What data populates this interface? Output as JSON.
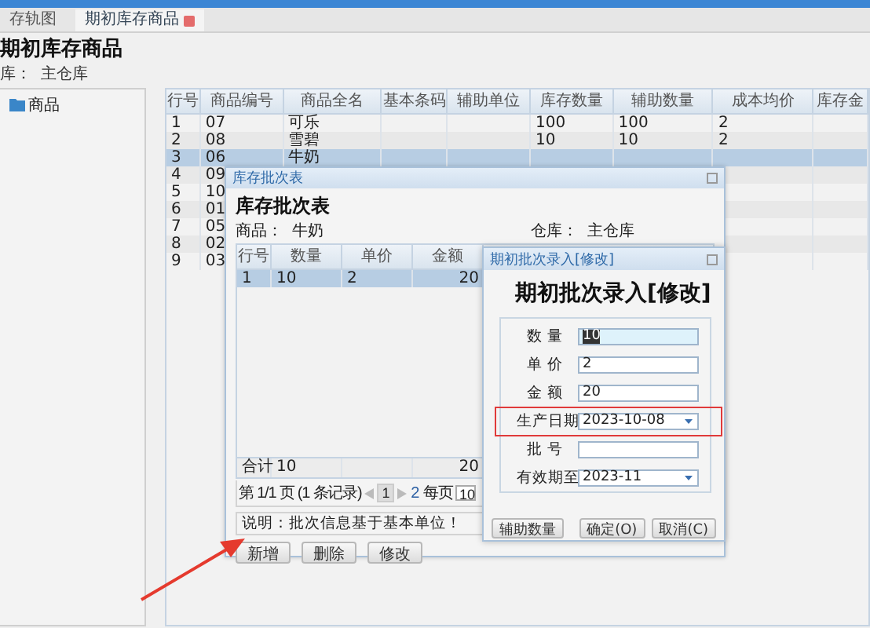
{
  "tabs": [
    {
      "label": "存轨图",
      "selected": false,
      "closable": false
    },
    {
      "label": "期初库存商品",
      "selected": true,
      "closable": true
    }
  ],
  "page": {
    "title": "期初库存商品",
    "warehouse_label": "库：",
    "warehouse": "主仓库"
  },
  "tree": {
    "items": [
      {
        "label": "商品"
      }
    ]
  },
  "grid": {
    "columns": [
      "行号",
      "商品编号",
      "商品全名",
      "基本条码",
      "辅助单位",
      "库存数量",
      "辅助数量",
      "成本均价",
      "库存金"
    ],
    "rows": [
      {
        "cells": [
          "1",
          "07",
          "可乐",
          "",
          "",
          "100",
          "100",
          "2",
          ""
        ],
        "selected": false
      },
      {
        "cells": [
          "2",
          "08",
          "雪碧",
          "",
          "",
          "10",
          "10",
          "2",
          ""
        ],
        "selected": false
      },
      {
        "cells": [
          "3",
          "06",
          "牛奶",
          "",
          "",
          "",
          "",
          "",
          ""
        ],
        "selected": true
      },
      {
        "cells": [
          "4",
          "09"
        ],
        "selected": false
      },
      {
        "cells": [
          "5",
          "10"
        ],
        "selected": false
      },
      {
        "cells": [
          "6",
          "01"
        ],
        "selected": false
      },
      {
        "cells": [
          "7",
          "05"
        ],
        "selected": false
      },
      {
        "cells": [
          "8",
          "02"
        ],
        "selected": false
      },
      {
        "cells": [
          "9",
          "03"
        ],
        "selected": false
      }
    ]
  },
  "batch_dialog": {
    "title": "库存批次表",
    "heading": "库存批次表",
    "product_label": "商品：",
    "product": "牛奶",
    "warehouse_label": "仓库：",
    "warehouse": "主仓库",
    "columns": [
      "行号",
      "数量",
      "单价",
      "金额"
    ],
    "rows": [
      {
        "cells": [
          "1",
          "10",
          "2",
          "20"
        ],
        "selected": true
      }
    ],
    "total": {
      "label": "合计",
      "cells": [
        "10",
        "",
        "20"
      ]
    },
    "pager": {
      "page_text": "第 1/1 页 (1 条记录)",
      "current": "1",
      "next": "2",
      "per_page_label": "每页",
      "per_page": "10"
    },
    "note": "说明：批次信息基于基本单位！",
    "buttons": [
      "新增",
      "删除",
      "修改"
    ]
  },
  "edit_dialog": {
    "title": "期初批次录入[修改]",
    "heading": "期初批次录入[修改]",
    "fields": [
      {
        "label": "数 量",
        "value": "10",
        "kind": "text",
        "focused": true,
        "highlighted": false
      },
      {
        "label": "单 价",
        "value": "2",
        "kind": "text",
        "focused": false,
        "highlighted": false
      },
      {
        "label": "金 额",
        "value": "20",
        "kind": "text",
        "focused": false,
        "highlighted": false
      },
      {
        "label": "生产日期",
        "value": "2023-10-08",
        "kind": "dropdown",
        "focused": false,
        "highlighted": true
      },
      {
        "label": "批 号",
        "kind": "text",
        "focused": false,
        "highlighted": false
      },
      {
        "label": "有效期至",
        "value": "2023-11",
        "kind": "dropdown",
        "focused": false,
        "highlighted": false
      }
    ],
    "buttons_left": [
      "辅助数量"
    ],
    "buttons_right": [
      "确定(O)",
      "取消(C)"
    ]
  }
}
